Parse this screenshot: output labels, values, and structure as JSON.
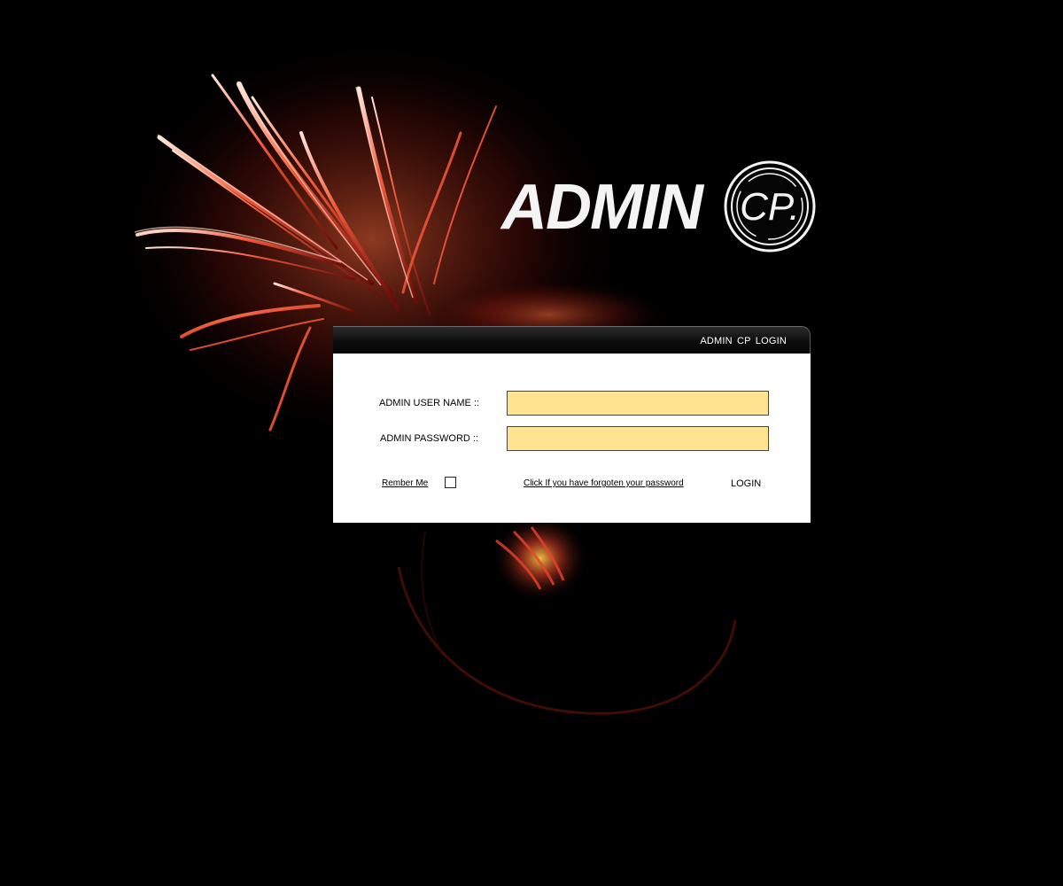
{
  "logo": {
    "word": "ADMIN",
    "seal_letters": "CP."
  },
  "panel": {
    "title": "ADMIN  CP  LOGIN"
  },
  "form": {
    "username_label": "ADMIN USER NAME ::",
    "username_value": "",
    "password_label": "ADMIN PASSWORD ::",
    "password_value": "",
    "remember_label": "Rember Me",
    "remember_checked": false,
    "forgot_link": "Click If you have forgoten your password",
    "login_button": "LOGIN"
  },
  "colors": {
    "background": "#000000",
    "input_fill": "#ffe391",
    "flame_accent": "#e8432a",
    "panel_body": "#ffffff"
  }
}
